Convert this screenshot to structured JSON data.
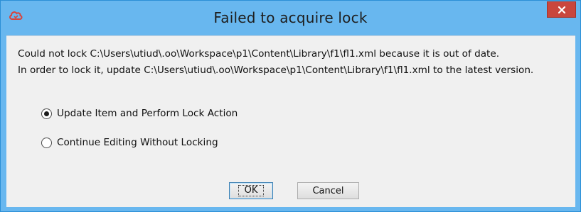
{
  "window": {
    "title": "Failed to acquire lock",
    "app_icon": "cloud-app-icon",
    "close_icon": "close-x-icon"
  },
  "message": {
    "line1": "Could not lock C:\\Users\\utiud\\.oo\\Workspace\\p1\\Content\\Library\\f1\\fl1.xml because it is out of date.",
    "line2": "In order to lock it, update C:\\Users\\utiud\\.oo\\Workspace\\p1\\Content\\Library\\f1\\fl1.xml to the latest version."
  },
  "options": [
    {
      "label": "Update Item and Perform Lock Action",
      "selected": true
    },
    {
      "label": "Continue Editing Without Locking",
      "selected": false
    }
  ],
  "buttons": {
    "ok_label": "OK",
    "cancel_label": "Cancel"
  },
  "colors": {
    "titlebar": "#68b7ef",
    "close": "#c9463d",
    "accent_icon": "#d9433a",
    "client_bg": "#f0f0f0"
  }
}
